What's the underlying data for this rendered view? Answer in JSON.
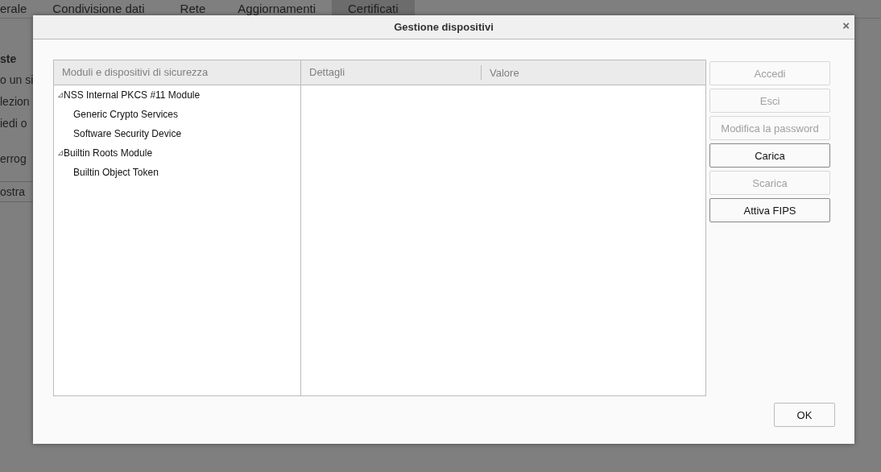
{
  "background_page": {
    "tabs": [
      {
        "label": "erale",
        "selected": false
      },
      {
        "label": "Condivisione dati",
        "selected": false
      },
      {
        "label": "Rete",
        "selected": false
      },
      {
        "label": "Aggiornamenti",
        "selected": false
      },
      {
        "label": "Certificati",
        "selected": true
      }
    ],
    "heading": "ste",
    "lines": [
      "o un si",
      "lezion",
      "iedi o"
    ],
    "line_after": "errog",
    "button": "ostra"
  },
  "dialog": {
    "title": "Gestione dispositivi",
    "close": "×",
    "tree": {
      "column": "Moduli e dispositivi di sicurezza",
      "items": [
        {
          "label": "NSS Internal PKCS #11 Module",
          "expanded": true,
          "children": [
            {
              "label": "Generic Crypto Services"
            },
            {
              "label": "Software Security Device"
            }
          ]
        },
        {
          "label": "Builtin Roots Module",
          "expanded": true,
          "children": [
            {
              "label": "Builtin Object Token"
            }
          ]
        }
      ]
    },
    "details": {
      "columns": [
        "Dettagli",
        "Valore"
      ]
    },
    "buttons": [
      {
        "label": "Accedi",
        "disabled": true
      },
      {
        "label": "Esci",
        "disabled": true
      },
      {
        "label": "Modifica la password",
        "disabled": true
      },
      {
        "label": "Carica",
        "disabled": false
      },
      {
        "label": "Scarica",
        "disabled": true
      },
      {
        "label": "Attiva FIPS",
        "disabled": false
      }
    ],
    "ok": "OK"
  }
}
